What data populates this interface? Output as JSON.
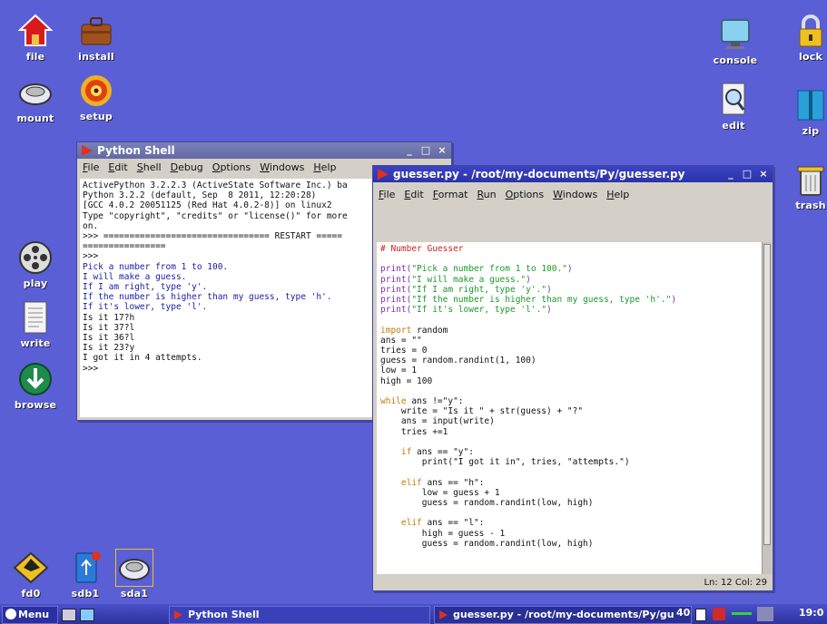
{
  "desktop_icons": {
    "file": "file",
    "install": "install",
    "mount": "mount",
    "setup": "setup",
    "play": "play",
    "write": "write",
    "browse": "browse",
    "console": "console",
    "lock": "lock",
    "edit": "edit",
    "zip": "zip",
    "trash": "trash",
    "fd0": "fd0",
    "sdb1": "sdb1",
    "sda1": "sda1"
  },
  "shell": {
    "title": "Python Shell",
    "menu": [
      "File",
      "Edit",
      "Shell",
      "Debug",
      "Options",
      "Windows",
      "Help"
    ],
    "lines": [
      "ActivePython 3.2.2.3 (ActiveState Software Inc.) ba",
      "Python 3.2.2 (default, Sep  8 2011, 12:20:28)",
      "[GCC 4.0.2 20051125 (Red Hat 4.0.2-8)] on linux2",
      "Type \"copyright\", \"credits\" or \"license()\" for more",
      "on.",
      ">>> ================================ RESTART =====",
      "================",
      ">>>",
      "Pick a number from 1 to 100.",
      "I will make a guess.",
      "If I am right, type 'y'.",
      "If the number is higher than my guess, type 'h'.",
      "If it's lower, type 'l'.",
      "Is it 17?h",
      "Is it 37?l",
      "Is it 36?l",
      "Is it 23?y",
      "I got it in 4 attempts.",
      ">>>"
    ]
  },
  "editor": {
    "title": "guesser.py - /root/my-documents/Py/guesser.py",
    "menu": [
      "File",
      "Edit",
      "Format",
      "Run",
      "Options",
      "Windows",
      "Help"
    ],
    "status": "Ln: 12 Col: 29",
    "code": [
      {
        "t": "c",
        "v": "# Number Guesser"
      },
      {
        "t": "n",
        "v": ""
      },
      {
        "t": "p",
        "a": "print(",
        "b": "\"Pick a number from 1 to 100.\"",
        "c": ")"
      },
      {
        "t": "p",
        "a": "print(",
        "b": "\"I will make a guess.\"",
        "c": ")"
      },
      {
        "t": "p",
        "a": "print(",
        "b": "\"If I am right, type 'y'.\"",
        "c": ")"
      },
      {
        "t": "p",
        "a": "print(",
        "b": "\"If the number is higher than my guess, type 'h'.\"",
        "c": ")"
      },
      {
        "t": "p",
        "a": "print(",
        "b": "\"If it's lower, type 'l'.\"",
        "c": ")"
      },
      {
        "t": "n",
        "v": ""
      },
      {
        "t": "k",
        "a": "import",
        "b": " random"
      },
      {
        "t": "n",
        "v": "ans = \"\""
      },
      {
        "t": "n",
        "v": "tries = 0"
      },
      {
        "t": "n",
        "v": "guess = random.randint(1, 100)"
      },
      {
        "t": "n",
        "v": "low = 1"
      },
      {
        "t": "n",
        "v": "high = 100"
      },
      {
        "t": "n",
        "v": ""
      },
      {
        "t": "k",
        "a": "while",
        "b": " ans !=\"y\":"
      },
      {
        "t": "n",
        "v": "    write = \"Is it \" + str(guess) + \"?\""
      },
      {
        "t": "n",
        "v": "    ans = input(write)"
      },
      {
        "t": "n",
        "v": "    tries +=1"
      },
      {
        "t": "n",
        "v": ""
      },
      {
        "t": "k",
        "a": "    if",
        "b": " ans == \"y\":"
      },
      {
        "t": "n",
        "v": "        print(\"I got it in\", tries, \"attempts.\")"
      },
      {
        "t": "n",
        "v": ""
      },
      {
        "t": "k",
        "a": "    elif",
        "b": " ans == \"h\":"
      },
      {
        "t": "n",
        "v": "        low = guess + 1"
      },
      {
        "t": "n",
        "v": "        guess = random.randint(low, high)"
      },
      {
        "t": "n",
        "v": ""
      },
      {
        "t": "k",
        "a": "    elif",
        "b": " ans == \"l\":"
      },
      {
        "t": "n",
        "v": "        high = guess - 1"
      },
      {
        "t": "n",
        "v": "        guess = random.randint(low, high)"
      }
    ]
  },
  "taskbar": {
    "menu_label": "Menu",
    "task_shell": "Python Shell",
    "task_editor": "guesser.py - /root/my-documents/Py/gu",
    "volume": "40",
    "clock": "19:0"
  },
  "colors": {
    "desktop": "#5a5fd6",
    "titlebar_active": "#2c33a8",
    "keyword": "#c47a00",
    "string": "#1a9a2a",
    "comment": "#cc2222"
  }
}
